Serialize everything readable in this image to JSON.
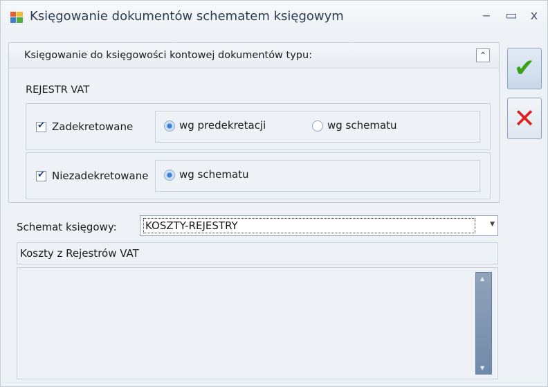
{
  "window": {
    "title": "Księgowanie dokumentów schematem księgowym",
    "minimize_glyph": "‒",
    "maximize_glyph": "▭",
    "close_glyph": "x"
  },
  "group": {
    "caption": "Księgowanie do księgowości kontowej dokumentów typu:",
    "collapse_glyph": "⌃",
    "register_label": "REJESTR VAT",
    "rows": [
      {
        "checkbox_label": "Zadekretowane",
        "checked": true,
        "options": [
          {
            "label": "wg predekretacji",
            "selected": true
          },
          {
            "label": "wg schematu",
            "selected": false
          }
        ]
      },
      {
        "checkbox_label": "Niezadekretowane",
        "checked": true,
        "options": [
          {
            "label": "wg schematu",
            "selected": true
          }
        ]
      }
    ]
  },
  "schema": {
    "label": "Schemat księgowy:",
    "value": "KOSZTY-REJESTRY",
    "description": "Koszty z Rejestrów VAT"
  },
  "buttons": {
    "ok_icon": "check-icon",
    "cancel_icon": "x-icon"
  },
  "colors": {
    "ok": "#3aa21a",
    "cancel": "#e01e1e",
    "accent": "#3d7fd3"
  }
}
